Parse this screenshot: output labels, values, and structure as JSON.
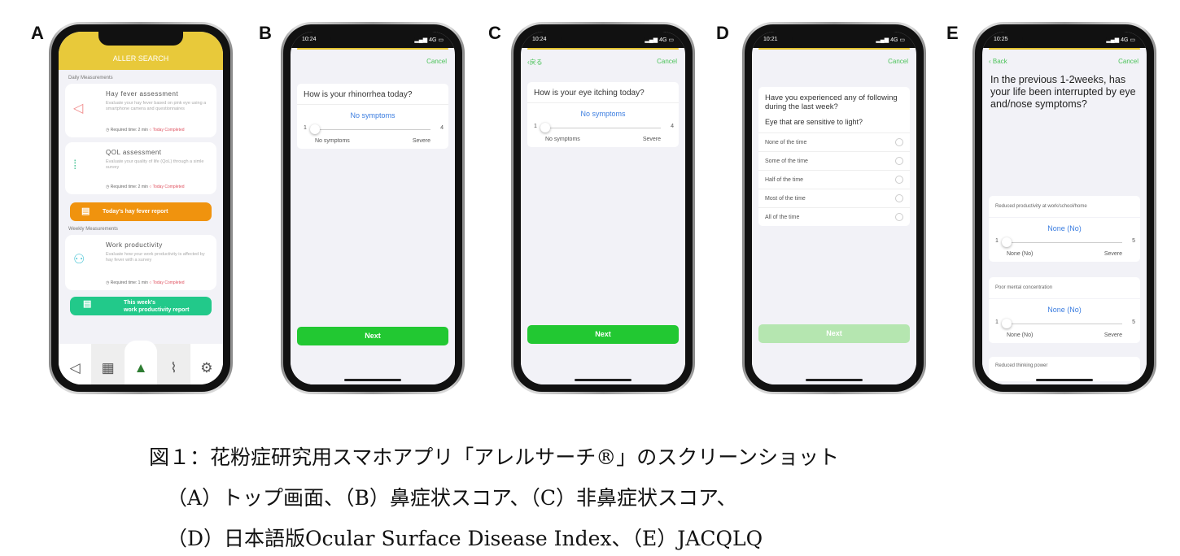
{
  "panel_labels": [
    "A",
    "B",
    "C",
    "D",
    "E"
  ],
  "colors": {
    "brand_yellow": "#e8c93a",
    "accent_green": "#22c832",
    "link_blue": "#3b7de0",
    "orange": "#f0930e",
    "teal": "#22c98a"
  },
  "phone_a": {
    "logo": "ALLER SEARCH",
    "daily_label": "Daily Measurements",
    "cards": [
      {
        "title": "Hay fever assessment",
        "desc": "Evaluate your hay fever based on pink eye using a smartphone camera and questionnaires",
        "time": "Required time: 2 min",
        "status": "Today Completed",
        "icon": "eye-icon"
      },
      {
        "title": "QOL assessment",
        "desc": "Evaluate your quality of life (QoL) through a simle survey",
        "time": "Required time: 2 min",
        "status": "Today Completed",
        "icon": "footprints-icon"
      }
    ],
    "report_button": "Today's hay fever report",
    "weekly_label": "Weekly Measurements",
    "weekly_card": {
      "title": "Work productivity",
      "desc": "Evaluate how your work productivity is affected by hay fever with a survey",
      "time": "Required time: 1 min",
      "status": "Today Completed",
      "icon": "people-icon"
    },
    "weekly_button_line1": "This week's",
    "weekly_button_line2": "work productivity report",
    "tabs": [
      "eye-icon",
      "calendar-icon",
      "tree-icon",
      "map-icon",
      "gear-icon"
    ]
  },
  "phone_b": {
    "time": "10:24",
    "signal": "4G",
    "cancel": "Cancel",
    "question": "How is your rhinorrhea today?",
    "value": "No symptoms",
    "min": "1",
    "max": "4",
    "min_label": "No symptoms",
    "max_label": "Severe",
    "next": "Next"
  },
  "phone_c": {
    "time": "10:24",
    "signal": "4G",
    "back": "戻る",
    "cancel": "Cancel",
    "question": "How is your eye itching today?",
    "value": "No symptoms",
    "min": "1",
    "max": "4",
    "min_label": "No symptoms",
    "max_label": "Severe",
    "next": "Next"
  },
  "phone_d": {
    "time": "10:21",
    "signal": "4G",
    "cancel": "Cancel",
    "question": "Have you experienced any of following during the last week?",
    "subquestion": "Eye that are sensitive to light?",
    "options": [
      "None of the time",
      "Some of the time",
      "Half of the time",
      "Most of the time",
      "All of the time"
    ],
    "next": "Next"
  },
  "phone_e": {
    "time": "10:25",
    "signal": "4G",
    "back": "Back",
    "cancel": "Cancel",
    "question": "In the previous 1-2weeks, has your life been interrupted by eye and/nose symptoms?",
    "items": [
      {
        "label": "Reduced productivity at work/school/home",
        "value": "None (No)",
        "min": "1",
        "max": "5",
        "min_label": "None (No)",
        "max_label": "Severe"
      },
      {
        "label": "Poor mental concentration",
        "value": "None (No)",
        "min": "1",
        "max": "5",
        "min_label": "None (No)",
        "max_label": "Severe"
      },
      {
        "label": "Reduced thinking power"
      }
    ]
  },
  "caption": {
    "line1": "図１：花粉症研究用スマホアプリ「アレルサーチ®」のスクリーンショット",
    "line2": "（A）トップ画面、（B）鼻症状スコア、（C）非鼻症状スコア、",
    "line3": "（D）日本語版Ocular Surface Disease Index、（E）JACQLQ"
  }
}
